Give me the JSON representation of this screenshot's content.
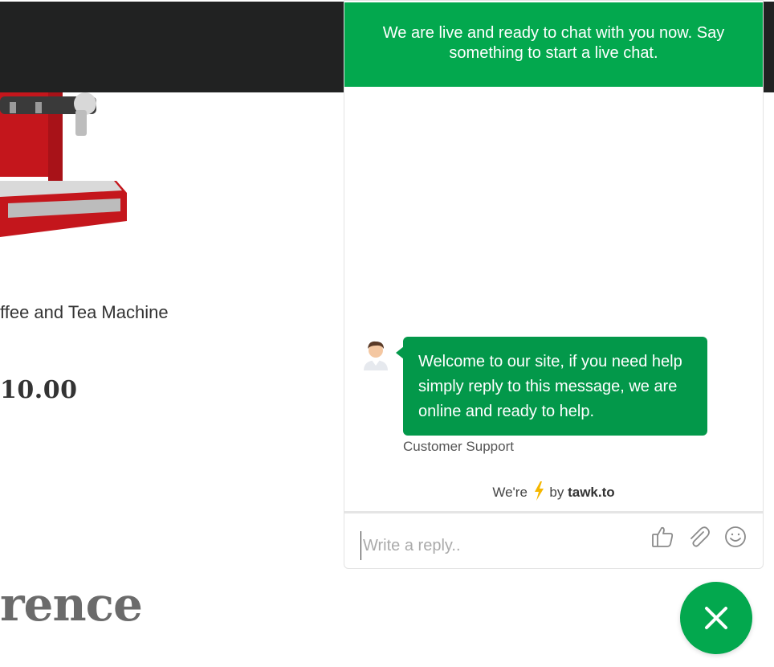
{
  "product": {
    "name": "ffee and Tea Machine",
    "price": "10.00"
  },
  "section": {
    "heading": "rence"
  },
  "chat": {
    "header": "We are live and ready to chat with you now. Say something to start a live chat.",
    "message": "Welcome to our site, if you need help simply reply to this message, we are online and ready to help.",
    "sender": "Customer Support",
    "powered_prefix": "We're",
    "powered_by": "by",
    "brand": "tawk.to",
    "reply_placeholder": "Write a reply..",
    "accent_color": "#03a84e"
  },
  "icons": [
    "thumbs-up-icon",
    "paperclip-icon",
    "smiley-icon",
    "close-icon",
    "lightning-bolt-icon"
  ]
}
